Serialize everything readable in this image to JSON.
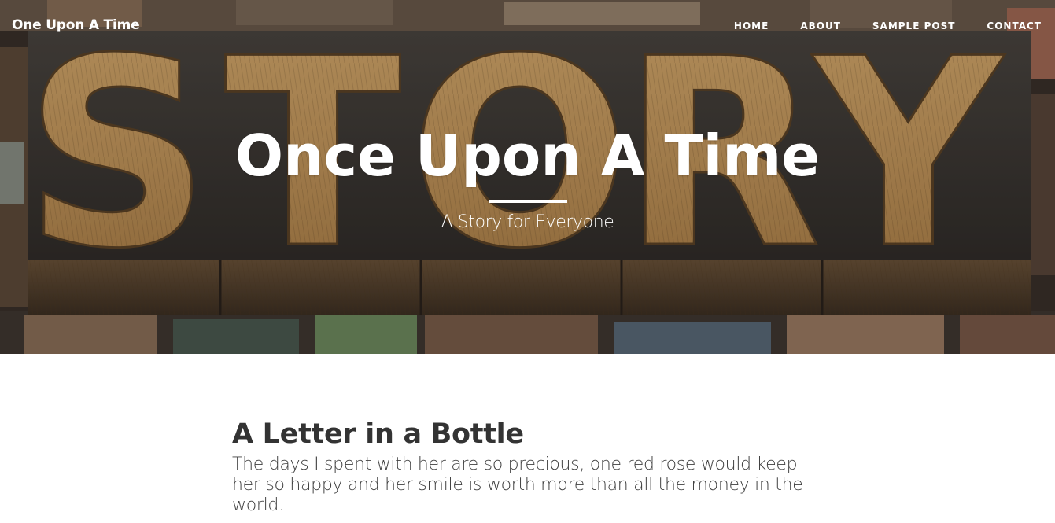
{
  "navbar": {
    "brand": "One Upon A Time",
    "links": [
      {
        "label": "HOME"
      },
      {
        "label": "ABOUT"
      },
      {
        "label": "SAMPLE POST"
      },
      {
        "label": "CONTACT"
      }
    ]
  },
  "hero": {
    "title": "Once Upon A Time",
    "subheading": "A Story for Everyone",
    "background_word": "STORY",
    "colors": {
      "wood_light": "#c79a5c",
      "wood_dark": "#3a3530",
      "text": "#ffffff"
    }
  },
  "post": {
    "title": "A Letter in a Bottle",
    "subtitle": "The days I spent with her are so precious, one red rose would keep her so happy and her smile is worth more than all the money in the world."
  }
}
